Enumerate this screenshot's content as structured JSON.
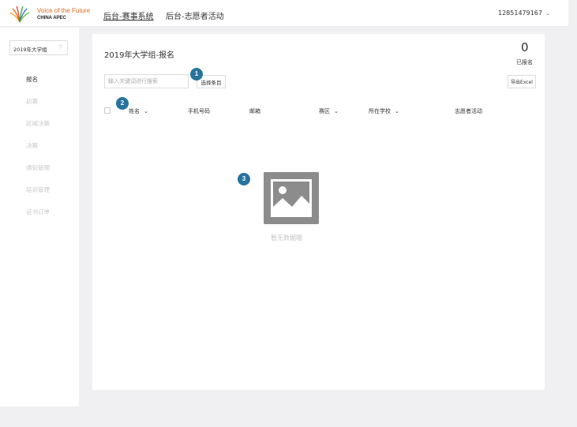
{
  "header": {
    "logo_line1": "Voice of the Future",
    "logo_line2": "CHINA APEC",
    "nav": [
      "后台-赛事系统",
      "后台-志愿者活动"
    ],
    "user": "12851479167",
    "user_caret": "⌄"
  },
  "sidebar": {
    "group_selected": "2019年大学组",
    "items": [
      {
        "label": "报名",
        "active": true
      },
      {
        "label": "初赛",
        "active": false
      },
      {
        "label": "区域决赛",
        "active": false
      },
      {
        "label": "决赛",
        "active": false
      },
      {
        "label": "通知管理",
        "active": false
      },
      {
        "label": "培训管理",
        "active": false
      },
      {
        "label": "证书订单",
        "active": false
      }
    ]
  },
  "main": {
    "title": "2019年大学组-报名",
    "count": "0",
    "count_label": "已报名",
    "search_placeholder": "输入关键词进行搜索",
    "choose_button": "选择条目",
    "export_button": "导出Excel",
    "columns": [
      "姓名",
      "手机号码",
      "邮箱",
      "赛区",
      "所在学校",
      "志愿者活动"
    ],
    "empty_text": "暂无数据哦"
  },
  "badges": [
    "1",
    "2",
    "3"
  ],
  "colors": {
    "badge": "#27739e",
    "logo_orange": "#e46a1e",
    "empty_icon": "#8c8c8c"
  }
}
